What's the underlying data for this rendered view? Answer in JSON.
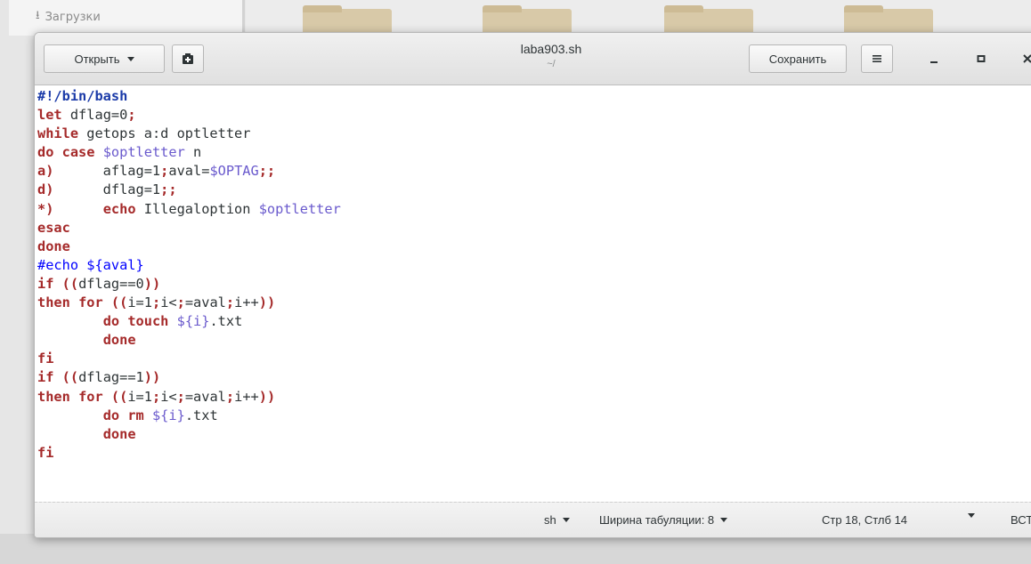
{
  "background": {
    "sidebar_item": "Загрузки",
    "folder_icon": "folder-icon"
  },
  "headerbar": {
    "open_label": "Открыть",
    "title": "laba903.sh",
    "subtitle": "~/",
    "save_label": "Сохранить",
    "icons": [
      "chevron-down-icon",
      "new-document-icon",
      "hamburger-menu-icon",
      "minimize-icon",
      "maximize-icon",
      "close-icon"
    ]
  },
  "editor": {
    "lines": [
      "#!/bin/bash",
      "let dflag=0;",
      "while getops a:d optletter",
      "do case $optletter n",
      "a)      aflag=1;aval=$OPTAG;;",
      "d)      dflag=1;;",
      "*)      echo Illegaloption $optletter",
      "esac",
      "done",
      "#echo ${aval}",
      "if ((dflag==0))",
      "then for ((i=1;i<=aval;i++))",
      "        do touch ${i}.txt",
      "        done",
      "fi",
      "if ((dflag==1))",
      "then for ((i=1;i<=aval;i++))",
      "        do rm ${i}.txt",
      "        done",
      "fi"
    ]
  },
  "statusbar": {
    "language": "sh",
    "tab_width": "Ширина табуляции: 8",
    "position": "Стр 18, Стлб 14",
    "mode": "ВСТ"
  },
  "colors": {
    "keyword": "#a52a2a",
    "variable": "#6a5acd",
    "comment": "#0000ff"
  }
}
